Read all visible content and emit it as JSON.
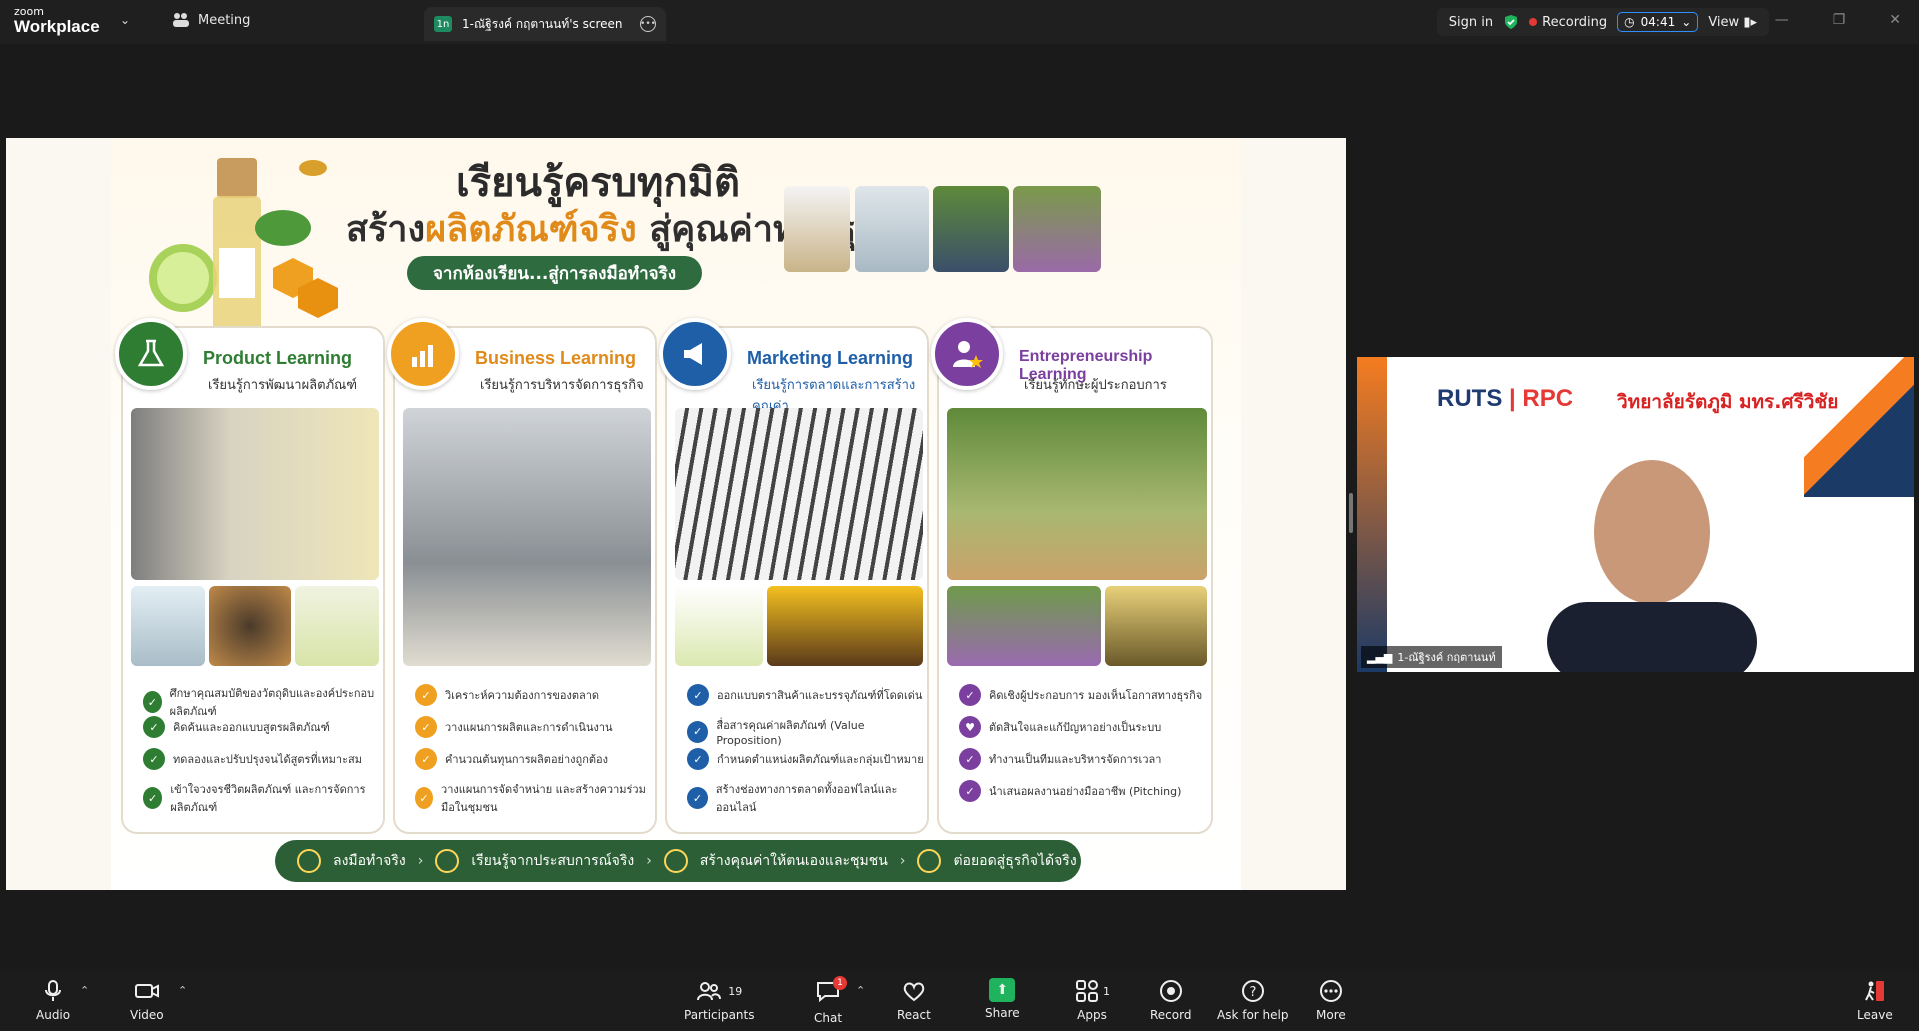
{
  "topbar": {
    "logo_top": "zoom",
    "logo_bottom": "Workplace",
    "meeting_label": "Meeting",
    "tab_badge": "1n",
    "tab_title": "1-ณัฐิรงค์ กฤตานนท์'s screen",
    "sign_in": "Sign in",
    "recording": "Recording",
    "timer": "04:41",
    "view": "View"
  },
  "slide": {
    "title_line1": "เรียนรู้ครบทุกมิติ",
    "title_line2_a": "สร้าง",
    "title_line2_b": "ผลิตภัณฑ์จริง",
    "title_line2_c": " สู่คุณค่าทางธุรกิจ",
    "subtitle_pill": "จากห้องเรียน...สู่การลงมือทำจริง",
    "cards": [
      {
        "title": "Product Learning",
        "subtitle": "เรียนรู้การพัฒนาผลิตภัณฑ์",
        "color": "#2e7d32",
        "bullets": [
          "ศึกษาคุณสมบัติของวัตถุดิบและองค์ประกอบผลิตภัณฑ์",
          "คิดค้นและออกแบบสูตรผลิตภัณฑ์",
          "ทดลองและปรับปรุงจนได้สูตรที่เหมาะสม",
          "เข้าใจวงจรชีวิตผลิตภัณฑ์ และการจัดการผลิตภัณฑ์"
        ]
      },
      {
        "title": "Business Learning",
        "subtitle": "เรียนรู้การบริหารจัดการธุรกิจ",
        "color": "#e08a1a",
        "bullets": [
          "วิเคราะห์ความต้องการของตลาด",
          "วางแผนการผลิตและการดำเนินงาน",
          "คำนวณต้นทุนการผลิตอย่างถูกต้อง",
          "วางแผนการจัดจำหน่าย และสร้างความร่วมมือในชุมชน"
        ]
      },
      {
        "title": "Marketing Learning",
        "subtitle": "เรียนรู้การตลาดและการสร้างคุณค่า",
        "color": "#1f5fa8",
        "bullets": [
          "ออกแบบตราสินค้าและบรรจุภัณฑ์ที่โดดเด่น",
          "สื่อสารคุณค่าผลิตภัณฑ์ (Value Proposition)",
          "กำหนดตำแหน่งผลิตภัณฑ์และกลุ่มเป้าหมาย",
          "สร้างช่องทางการตลาดทั้งออฟไลน์และออนไลน์"
        ]
      },
      {
        "title": "Entrepreneurship Learning",
        "subtitle": "เรียนรู้ทักษะผู้ประกอบการ",
        "color": "#7b3fa0",
        "bullets": [
          "คิดเชิงผู้ประกอบการ มองเห็นโอกาสทางธุรกิจ",
          "ตัดสินใจและแก้ปัญหาอย่างเป็นระบบ",
          "ทำงานเป็นทีมและบริหารจัดการเวลา",
          "นำเสนอผลงานอย่างมืออาชีพ (Pitching)"
        ]
      }
    ],
    "footer": [
      "ลงมือทำจริง",
      "เรียนรู้จากประสบการณ์จริง",
      "สร้างคุณค่าให้ตนเองและชุมชน",
      "ต่อยอดสู่ธุรกิจได้จริง"
    ]
  },
  "video": {
    "brand_a": "RUTS",
    "brand_sep": "|",
    "brand_b": "RPC",
    "thai_name": "วิทยาลัยรัตภูมิ มทร.ศรีวิชัย",
    "nametag": "1-ณัฐิรงค์ กฤตานนท์"
  },
  "bottombar": {
    "audio": "Audio",
    "video": "Video",
    "participants": "Participants",
    "participants_count": "19",
    "chat": "Chat",
    "chat_badge": "1",
    "react": "React",
    "share": "Share",
    "apps": "Apps",
    "apps_count": "1",
    "record": "Record",
    "help": "Ask for help",
    "more": "More",
    "leave": "Leave"
  }
}
